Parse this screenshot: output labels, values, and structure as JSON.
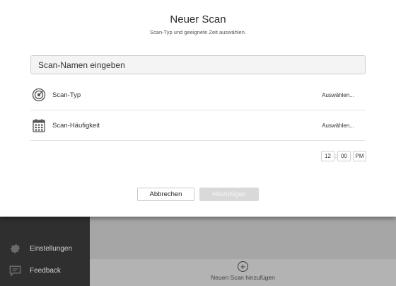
{
  "dialog": {
    "title": "Neuer Scan",
    "subtitle": "Scan-Typ und geeignete Zeit auswählen.",
    "name_placeholder": "Scan-Namen eingeben",
    "scan_type": {
      "label": "Scan-Typ",
      "action": "Auswählen...",
      "icon": "scan-target-icon"
    },
    "scan_frequency": {
      "label": "Scan-Häufigkeit",
      "action": "Auswählen...",
      "icon": "calendar-icon"
    },
    "time": {
      "hour": "12",
      "separator": ":",
      "minute": "00",
      "ampm": "PM"
    },
    "cancel_label": "Abbrechen",
    "add_label": "Hinzufügen"
  },
  "sidebar": {
    "items": [
      {
        "label": "Einstellungen",
        "icon": "gear-icon"
      },
      {
        "label": "Feedback",
        "icon": "feedback-icon"
      }
    ]
  },
  "main": {
    "add_scan_label": "Neuen Scan hinzufügen",
    "add_scan_icon": "plus-circle-icon"
  },
  "colors": {
    "dialog_bg": "#ffffff",
    "sidebar_bg": "#2f2f2f",
    "overlay_bg": "#a6a6a6",
    "disabled_button": "#d9d9d9"
  }
}
